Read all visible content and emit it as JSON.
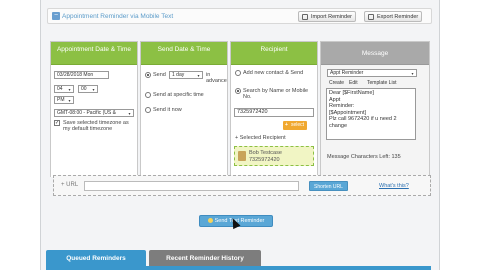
{
  "header": {
    "title": "Appointment Reminder via Mobile Text",
    "import_label": "Import Reminder",
    "export_label": "Export Reminder"
  },
  "columns": {
    "appointment": {
      "heading": "Appointment Date & Time",
      "date_value": "03/28/2018 Mon",
      "hour_value": "04",
      "minute_value": "00",
      "ampm_value": "PM",
      "timezone_value": "GMT-08:00 - Pacific (US &",
      "save_timezone_label": "Save selected timezone as my default timezone"
    },
    "send": {
      "heading": "Send Date & Time",
      "option1_prefix": "Send",
      "option1_value": "1 day",
      "option1_suffix": "in advance",
      "option2": "Send at specific time",
      "option3": "Send it now"
    },
    "recipient": {
      "heading": "Recipient",
      "option_add": "Add new contact & Send",
      "option_search": "Search by Name or Mobile No.",
      "search_value": "7325972420",
      "add_button": "select",
      "selected_label": "Selected Recipient",
      "selected_name": "Bob Testcase",
      "selected_phone": "7325972420"
    },
    "message": {
      "heading": "Message",
      "template_value": "Appt Reminder",
      "create_label": "Create",
      "edit_label": "Edit",
      "template_list_label": "Template List",
      "body_lines": [
        "Dear [$FirstName]",
        "Appt",
        "Reminder:",
        "[$Appointment]",
        "Plz call 9672420 if u need 2",
        "change"
      ],
      "chars_left": "Message Characters Left: 135"
    }
  },
  "url_row": {
    "label": "+ URL",
    "shorten_button": "Shorten URL",
    "whats_this": "What's this?"
  },
  "send_button": "Send Text Reminder",
  "tabs": {
    "queued": "Queued Reminders",
    "history": "Recent Reminder History"
  }
}
